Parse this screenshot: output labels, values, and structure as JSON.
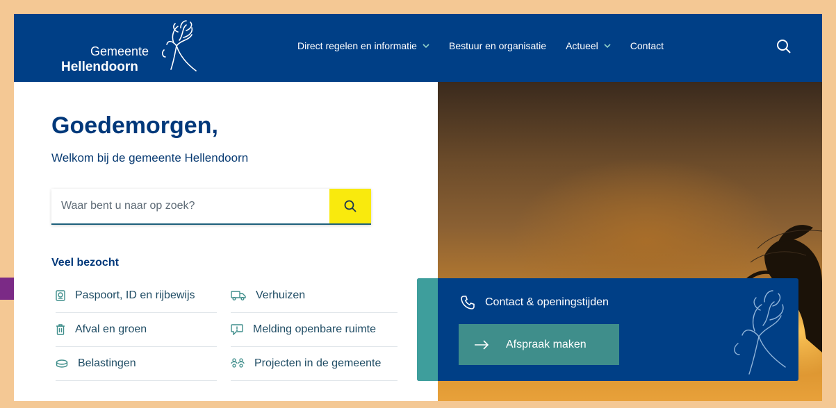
{
  "header": {
    "logo_word1": "Gemeente",
    "logo_word2": "Hellendoorn",
    "nav": [
      {
        "label": "Direct regelen en informatie",
        "has_dropdown": true
      },
      {
        "label": "Bestuur en organisatie",
        "has_dropdown": false
      },
      {
        "label": "Actueel",
        "has_dropdown": true
      },
      {
        "label": "Contact",
        "has_dropdown": false
      }
    ]
  },
  "main": {
    "greeting": "Goedemorgen,",
    "welcome": "Welkom bij de gemeente Hellendoorn",
    "search_placeholder": "Waar bent u naar op zoek?",
    "popular_title": "Veel bezocht",
    "popular_left": [
      {
        "label": "Paspoort, ID en rijbewijs",
        "icon": "id-card-icon"
      },
      {
        "label": "Afval en groen",
        "icon": "trash-icon"
      },
      {
        "label": "Belastingen",
        "icon": "coins-icon"
      }
    ],
    "popular_right": [
      {
        "label": "Verhuizen",
        "icon": "truck-icon"
      },
      {
        "label": "Melding openbare ruimte",
        "icon": "message-alert-icon"
      },
      {
        "label": "Projecten in de gemeente",
        "icon": "people-icon"
      }
    ]
  },
  "panel": {
    "contact_label": "Contact & openingstijden",
    "appointment_label": "Afspraak maken"
  },
  "colors": {
    "header_bg": "#003f86",
    "accent_yellow": "#f9ea0d",
    "teal": "#3f8e8b",
    "annotation_arrow": "#7b2a86",
    "page_border": "#f4c894"
  }
}
